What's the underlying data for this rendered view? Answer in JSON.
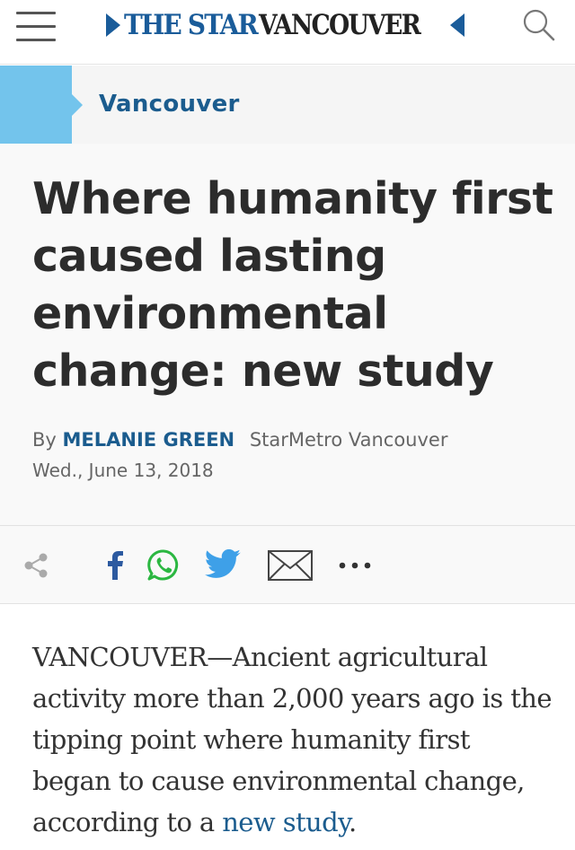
{
  "header": {
    "logo_brand": "THE STAR",
    "logo_city": "VANCOUVER",
    "menu_icon": "hamburger-icon",
    "search_icon": "search-icon",
    "brand_color": "#1a5c9a"
  },
  "section": {
    "label": "Vancouver",
    "accent_color": "#73c4ec"
  },
  "article": {
    "headline": "Where humanity first caused lasting environmental change: new study",
    "byline_prefix": "By",
    "author": "MELANIE GREEN",
    "outlet": "StarMetro Vancouver",
    "date": "Wed., June 13, 2018"
  },
  "share": {
    "items": [
      {
        "icon": "share-icon"
      },
      {
        "icon": "facebook-icon"
      },
      {
        "icon": "whatsapp-icon"
      },
      {
        "icon": "twitter-icon"
      },
      {
        "icon": "email-icon"
      },
      {
        "icon": "more-icon"
      }
    ]
  },
  "body": {
    "lede_text": "VANCOUVER—Ancient agricultural activity more than 2,000 years ago is the tipping point where humanity first began to cause environmental change, according to a ",
    "lede_link": "new study",
    "lede_end": "."
  }
}
